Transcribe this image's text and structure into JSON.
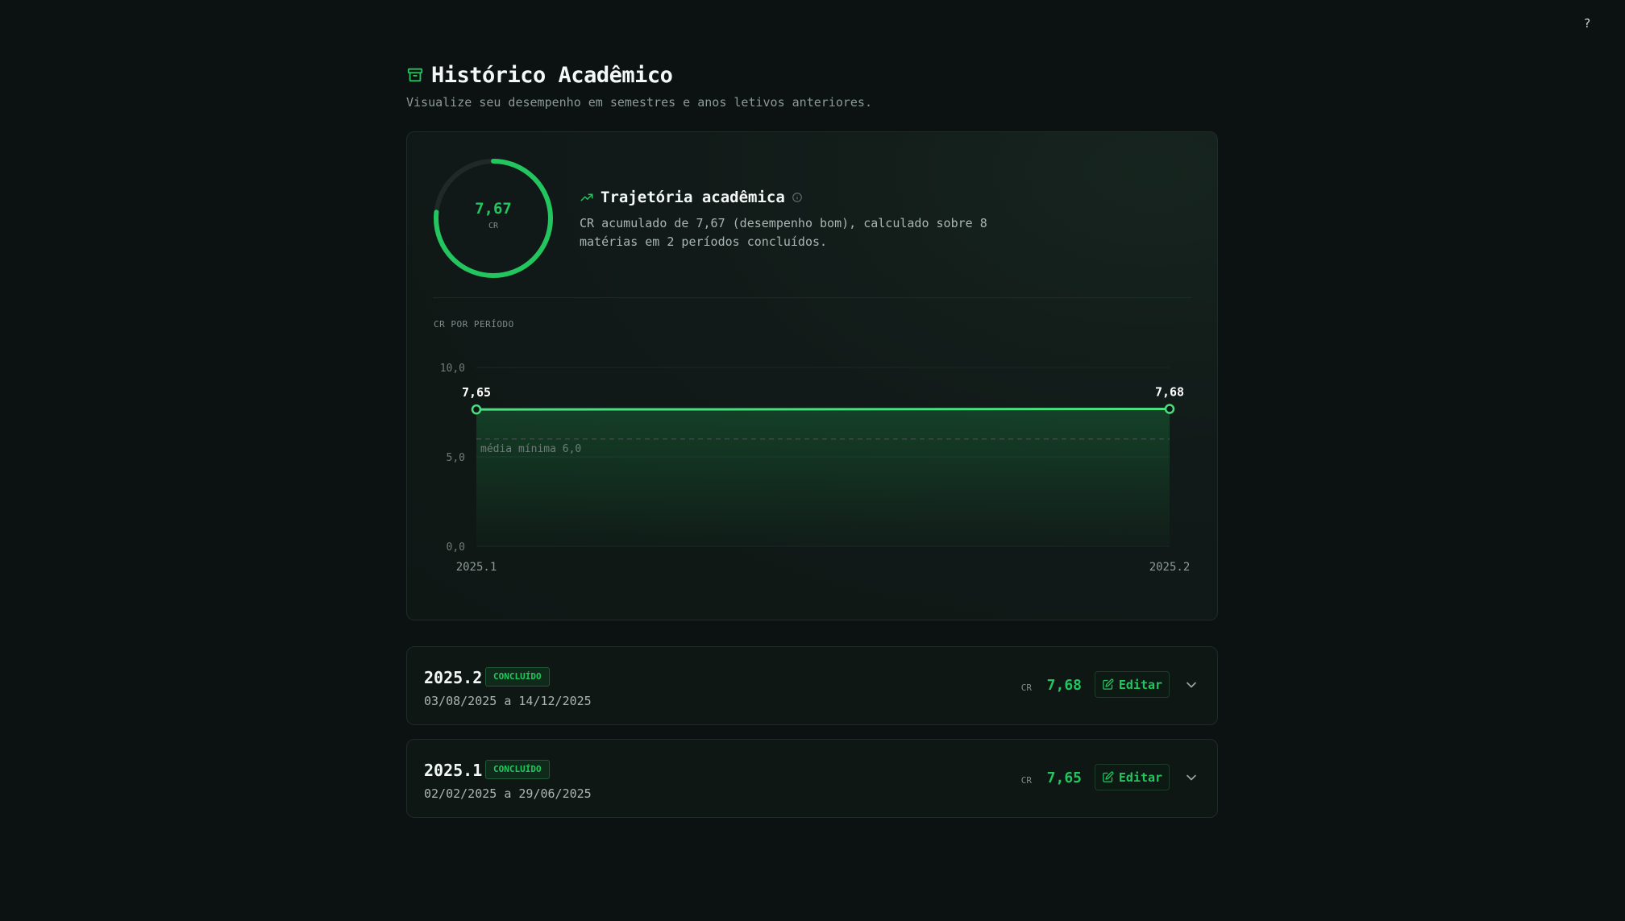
{
  "help": {
    "label": "?"
  },
  "header": {
    "title": "Histórico Acadêmico",
    "subtitle": "Visualize seu desempenho em semestres e anos letivos anteriores."
  },
  "summary": {
    "cr_value": "7,67",
    "cr_label": "CR",
    "cr_fraction": 0.767,
    "trajectory_title": "Trajetória acadêmica",
    "description": "CR acumulado de 7,67 (desempenho bom), calculado sobre 8 matérias em 2 períodos concluídos."
  },
  "chart_label": "CR POR PERÍODO",
  "chart_data": {
    "type": "area",
    "x": [
      "2025.1",
      "2025.2"
    ],
    "series": [
      {
        "values": [
          7.65,
          7.68
        ]
      }
    ],
    "data_labels": [
      "7,65",
      "7,68"
    ],
    "y_ticks": [
      "10,0",
      "5,0",
      "0,0"
    ],
    "ylim": [
      0,
      10
    ],
    "reference_line": {
      "value": 6.0,
      "label": "média mínima 6,0"
    },
    "grid": true,
    "colors": {
      "line": "#4ade80",
      "fill": "#22c55e"
    }
  },
  "periods": [
    {
      "name": "2025.2",
      "status": "CONCLUÍDO",
      "dates": "03/08/2025 a 14/12/2025",
      "cr_label": "CR",
      "cr": "7,68",
      "edit_label": "Editar"
    },
    {
      "name": "2025.1",
      "status": "CONCLUÍDO",
      "dates": "02/02/2025 a 29/06/2025",
      "cr_label": "CR",
      "cr": "7,65",
      "edit_label": "Editar"
    }
  ],
  "colors": {
    "accent": "#22c55e",
    "background": "#0b1211",
    "card": "#0f1715"
  }
}
